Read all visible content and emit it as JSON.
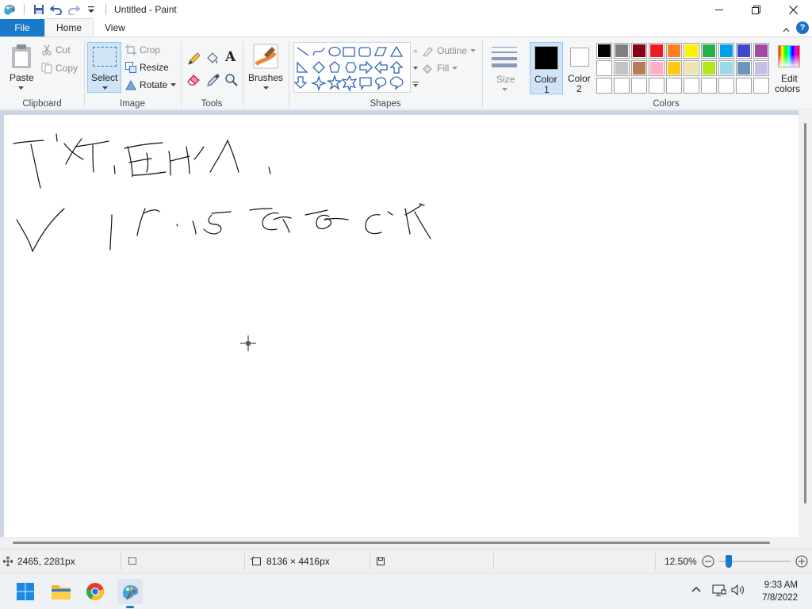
{
  "window": {
    "title": "Untitled - Paint"
  },
  "tabs": {
    "file": "File",
    "home": "Home",
    "view": "View"
  },
  "clipboard": {
    "paste": "Paste",
    "cut": "Cut",
    "copy": "Copy",
    "group": "Clipboard"
  },
  "image": {
    "select": "Select",
    "crop": "Crop",
    "resize": "Resize",
    "rotate": "Rotate",
    "group": "Image"
  },
  "tools": {
    "group": "Tools"
  },
  "brushes": {
    "label": "Brushes"
  },
  "shapes": {
    "outline": "Outline",
    "fill": "Fill",
    "group": "Shapes"
  },
  "size": {
    "label": "Size"
  },
  "colors": {
    "color1_line1": "Color",
    "color1_line2": "1",
    "color2_line1": "Color",
    "color2_line2": "2",
    "edit_line1": "Edit",
    "edit_line2": "colors",
    "group": "Colors",
    "color1": "#000000",
    "color2": "#ffffff",
    "palette": [
      "#000000",
      "#7f7f7f",
      "#880015",
      "#ed1c24",
      "#ff7f27",
      "#fff200",
      "#22b14c",
      "#00a2e8",
      "#3f48cc",
      "#a349a4",
      "#ffffff",
      "#c3c3c3",
      "#b97a57",
      "#ffaec9",
      "#ffc90e",
      "#efe4b0",
      "#b5e61d",
      "#99d9ea",
      "#7092be",
      "#c8bfe7",
      "#ffffff",
      "#ffffff",
      "#ffffff",
      "#ffffff",
      "#ffffff",
      "#ffffff",
      "#ffffff",
      "#ffffff",
      "#ffffff",
      "#ffffff"
    ]
  },
  "status": {
    "cursor_pos": "2465, 2281px",
    "image_size": "8136 × 4416px",
    "zoom": "12.50%",
    "zoom_level": 0.1
  },
  "taskbar": {
    "time": "9:33 AM",
    "date": "7/8/2022"
  }
}
